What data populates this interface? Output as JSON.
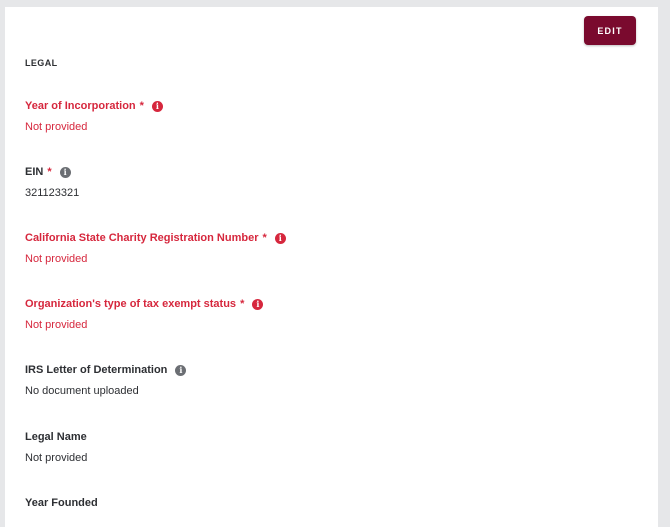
{
  "colors": {
    "page_background": "#e6e7e9",
    "card_background": "#ffffff",
    "primary_button": "#7a0a2e",
    "button_text": "#ffffff",
    "required_red": "#d6273d",
    "text_dark": "#2d2f33",
    "info_icon_gray": "#6b6e73"
  },
  "toolbar": {
    "edit_label": "EDIT"
  },
  "section": {
    "title": "LEGAL"
  },
  "icons": {
    "info": "info-icon"
  },
  "fields": [
    {
      "label": "Year of Incorporation",
      "required": true,
      "asterisk": "*",
      "has_info": true,
      "value": "Not provided",
      "missing": true
    },
    {
      "label": "EIN",
      "required": true,
      "asterisk": "*",
      "has_info": true,
      "value": "321123321",
      "missing": false
    },
    {
      "label": "California State Charity Registration Number",
      "required": true,
      "asterisk": "*",
      "has_info": true,
      "value": "Not provided",
      "missing": true
    },
    {
      "label": "Organization's type of tax exempt status",
      "required": true,
      "asterisk": "*",
      "has_info": true,
      "value": "Not provided",
      "missing": true
    },
    {
      "label": "IRS Letter of Determination",
      "required": false,
      "has_info": true,
      "value": "No document uploaded",
      "missing": false
    },
    {
      "label": "Legal Name",
      "required": false,
      "has_info": false,
      "value": "Not provided",
      "missing": false
    },
    {
      "label": "Year Founded",
      "required": false,
      "has_info": false,
      "value": "",
      "missing": false
    }
  ]
}
